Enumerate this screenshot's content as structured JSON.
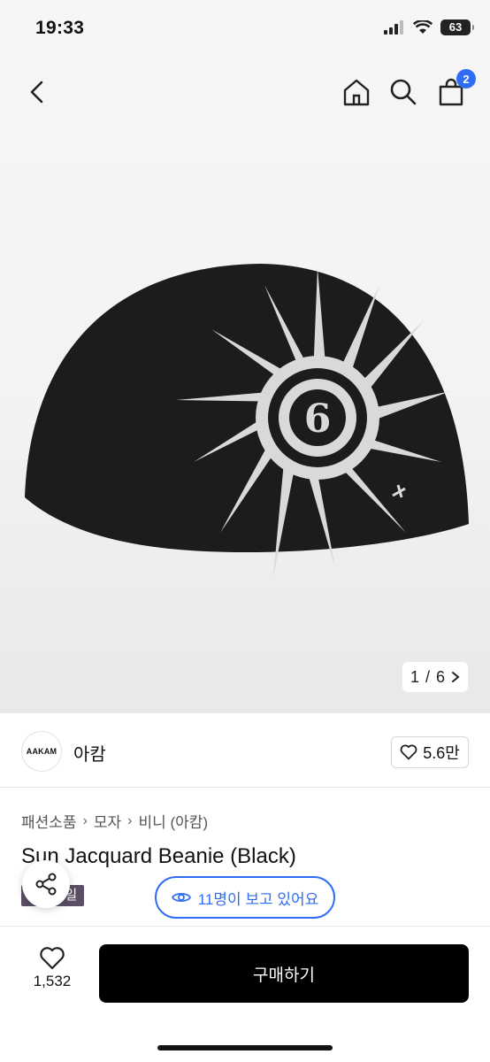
{
  "status_bar": {
    "time": "19:33",
    "battery": "63"
  },
  "nav": {
    "back_icon": "chevron-left-icon",
    "home_icon": "home-icon",
    "search_icon": "search-icon",
    "cart_icon": "shopping-bag-icon",
    "cart_count": "2"
  },
  "gallery": {
    "current": "1",
    "separator": "/",
    "total": "6"
  },
  "brand": {
    "logo_text": "AAKAM",
    "name": "아캄",
    "like_count": "5.6만"
  },
  "breadcrumb": [
    "패션소품",
    "모자",
    "비니 (아캄)"
  ],
  "product": {
    "title": "Sun Jacquard Beanie (Black)",
    "sale_badge": "시즌세일"
  },
  "viewing": {
    "text": "11명이 보고 있어요"
  },
  "bottom_bar": {
    "wish_count": "1,532",
    "buy_label": "구매하기"
  },
  "colors": {
    "accent": "#2f6df6",
    "badge_bg": "#5b4e64",
    "buy_bg": "#000000"
  }
}
